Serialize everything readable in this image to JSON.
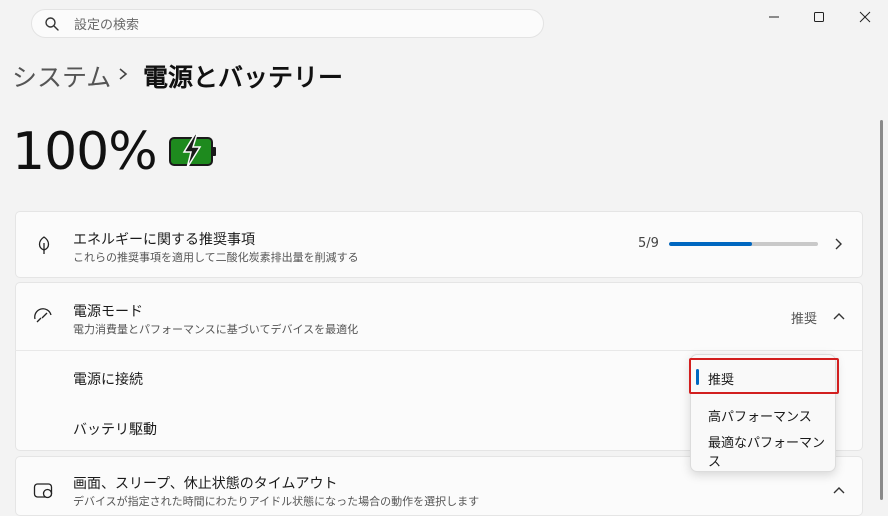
{
  "search": {
    "placeholder": "設定の検索"
  },
  "breadcrumb": {
    "parent": "システム",
    "separator": "›",
    "current": "電源とバッテリー"
  },
  "battery": {
    "percent_text": "100%",
    "icon": "battery-charging-icon",
    "color": "#1e8a1e"
  },
  "energy": {
    "title": "エネルギーに関する推奨事項",
    "subtitle": "これらの推奨事項を適用して二酸化炭素排出量を削減する",
    "progress_text": "5/9",
    "progress_fraction": 0.556
  },
  "power_mode": {
    "title": "電源モード",
    "subtitle": "電力消費量とパフォーマンスに基づいてデバイスを最適化",
    "value": "推奨",
    "rows": [
      "電源に接続",
      "バッテリ駆動"
    ]
  },
  "dropdown": {
    "options": [
      "推奨",
      "高パフォーマンス",
      "最適なパフォーマンス"
    ],
    "selected": "推奨"
  },
  "screen_sleep": {
    "title": "画面、スリープ、休止状態のタイムアウト",
    "subtitle": "デバイスが指定された時間にわたりアイドル状態になった場合の動作を選択します"
  },
  "colors": {
    "accent": "#0067c0",
    "highlight_border": "#d21f1f"
  }
}
